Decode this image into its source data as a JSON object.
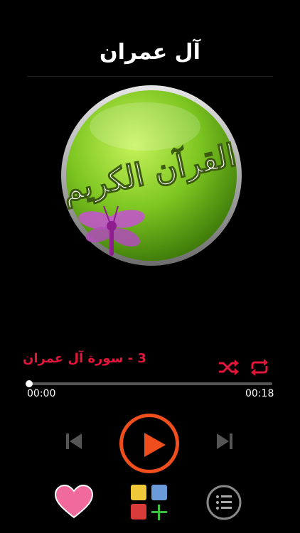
{
  "header": {
    "title": "آل عمران"
  },
  "logo": {
    "text": "القرآن الكريم"
  },
  "player": {
    "track_title": "3 - سورة  آل عمران",
    "current_time": "00:00",
    "duration": "00:18",
    "progress": 0.0
  },
  "colors": {
    "accent_red": "#e1163a",
    "play_orange": "#f04e1c",
    "heart_pink": "#f06a9c",
    "green_globe": "#7cc521"
  },
  "icons": {
    "shuffle": "shuffle-icon",
    "repeat": "repeat-icon",
    "previous": "skip-previous-icon",
    "play": "play-icon",
    "next": "skip-next-icon",
    "favorite": "heart-icon",
    "add_to_playlist": "grid-plus-icon",
    "list": "list-icon"
  }
}
